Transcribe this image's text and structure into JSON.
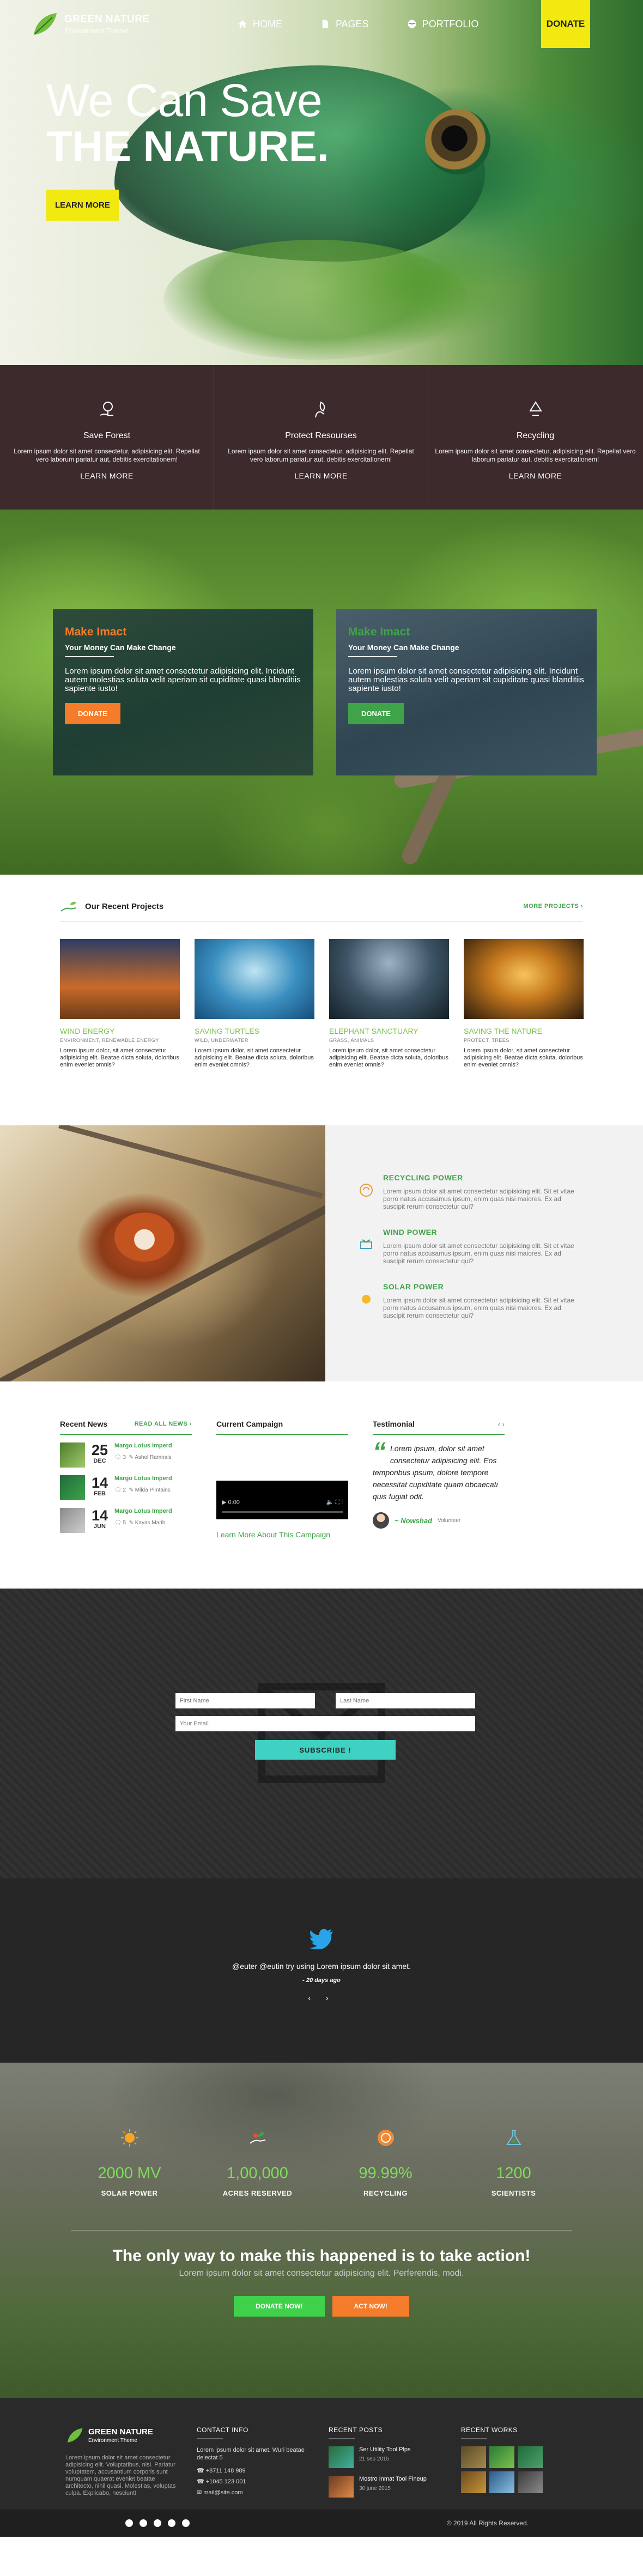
{
  "brand": {
    "title": "GREEN NATURE",
    "subtitle": "Environment Theme"
  },
  "nav": {
    "items": [
      {
        "label": "HOME",
        "icon": "home-icon"
      },
      {
        "label": "PAGES",
        "icon": "page-icon"
      },
      {
        "label": "PORTFOLIO",
        "icon": "globe-icon"
      }
    ],
    "donate": "DONATE"
  },
  "hero": {
    "line1": "We Can Save",
    "line2": "THE NATURE.",
    "button": "LEARN MORE"
  },
  "features": [
    {
      "icon": "tree-hand-icon",
      "title": "Save Forest",
      "text": "Lorem ipsum dolor sit amet consectetur, adipisicing elit. Repellat vero laborum pariatur aut, debitis exercitationem!",
      "button": "LEARN MORE"
    },
    {
      "icon": "hand-leaf-icon",
      "title": "Protect Resourses",
      "text": "Lorem ipsum dolor sit amet consectetur, adipisicing elit. Repellat vero laborum pariatur aut, debitis exercitationem!",
      "button": "LEARN MORE"
    },
    {
      "icon": "recycle-icon",
      "title": "Recycling",
      "text": "Lorem ipsum dolor sit amet consectetur, adipisicing elit. Repellat vero laborum pariatur aut, debitis exercitationem!",
      "button": "LEARN MORE"
    }
  ],
  "cards": [
    {
      "title": "Make Imact",
      "subtitle": "Your Money Can Make Change",
      "text": "Lorem ipsum dolor sit amet consectetur adipisicing elit. Incidunt autem molestias soluta velit aperiam sit cupiditate quasi blanditiis sapiente iusto!",
      "button": "DONATE"
    },
    {
      "title": "Make Imact",
      "subtitle": "Your Money Can Make Change",
      "text": "Lorem ipsum dolor sit amet consectetur adipisicing elit. Incidunt autem molestias soluta velit aperiam sit cupiditate quasi blanditiis sapiente iusto!",
      "button": "DONATE"
    }
  ],
  "projects": {
    "heading": "Our Recent Projects",
    "more": "MORE PROJECTS  ›",
    "items": [
      {
        "title": "WIND ENERGY",
        "tags": "ENVIRONMENT, RENEWABLE ENERGY",
        "text": "Lorem ipsum dolor, sit amet consectetur adipisicing elit. Beatae dicta soluta, doloribus enim eveniet omnis?"
      },
      {
        "title": "SAVING TURTLES",
        "tags": "WILD, UNDERWATER",
        "text": "Lorem ipsum dolor, sit amet consectetur adipisicing elit. Beatae dicta soluta, doloribus enim eveniet omnis?"
      },
      {
        "title": "ELEPHANT SANCTUARY",
        "tags": "GRASS, ANIMALS",
        "text": "Lorem ipsum dolor, sit amet consectetur adipisicing elit. Beatae dicta soluta, doloribus enim eveniet omnis?"
      },
      {
        "title": "SAVING THE NATURE",
        "tags": "PROTECT, TREES",
        "text": "Lorem ipsum dolor, sit amet consectetur adipisicing elit. Beatae dicta soluta, doloribus enim eveniet omnis?"
      }
    ]
  },
  "power": [
    {
      "icon": "recycle-power-icon",
      "title": "RECYCLING POWER",
      "text": "Lorem ipsum dolor sit amet consectetur adipisicing elit. Sit et vitae porro natus accusamus ipsum, enim quas nisi maiores. Ex ad suscipit rerum consectetur qui?"
    },
    {
      "icon": "wind-power-icon",
      "title": "WIND POWER",
      "text": "Lorem ipsum dolor sit amet consectetur adipisicing elit. Sit et vitae porro natus accusamus ipsum, enim quas nisi maiores. Ex ad suscipit rerum consectetur qui?"
    },
    {
      "icon": "solar-power-icon",
      "title": "SOLAR POWER",
      "text": "Lorem ipsum dolor sit amet consectetur adipisicing elit. Sit et vitae porro natus accusamus ipsum, enim quas nisi maiores. Ex ad suscipit rerum consectetur qui?"
    }
  ],
  "news": {
    "heading": "Recent News",
    "readall": "READ ALL NEWS ›",
    "items": [
      {
        "day": "25",
        "month": "DEC",
        "title": "Margo Lotus Imperd",
        "comments": "3",
        "author": "Ashol Ramnais"
      },
      {
        "day": "14",
        "month": "FEB",
        "title": "Margo Lotus Imperd",
        "comments": "2",
        "author": "Milda Pimtains"
      },
      {
        "day": "14",
        "month": "JUN",
        "title": "Margo Lotus Imperd",
        "comments": "5",
        "author": "Kayas Marib"
      }
    ]
  },
  "campaign": {
    "heading": "Current Campaign",
    "time": "0:00",
    "link": "Learn More About This Campaign"
  },
  "testimonial": {
    "heading": "Testimonial",
    "nav": "‹ ›",
    "quote": "Lorem ipsum, dolor sit amet consectetur adipisicing elit. Eos temporibus ipsum, dolore tempore necessitat cupiditate quam obcaecati quis fugiat odit.",
    "author": "~ Nowshad",
    "role": "Volunteer"
  },
  "newsletter": {
    "first": "First Name",
    "last": "Last Name",
    "email": "Your Email",
    "button": "SUBSCRIBE !"
  },
  "tweet": {
    "text": "@euter @eutin try using Lorem ipsum dolor sit amet.",
    "handle": "@euter @eutin",
    "ago": "- 20 days ago",
    "arrows": "‹ ›"
  },
  "stats": {
    "items": [
      {
        "icon": "sun-icon",
        "value": "2000 MV",
        "label": "SOLAR POWER"
      },
      {
        "icon": "hand-plant-icon",
        "value": "1,00,000",
        "label": "ACRES RESERVED"
      },
      {
        "icon": "recycle-badge-icon",
        "value": "99.99%",
        "label": "RECYCLING"
      },
      {
        "icon": "scientist-icon",
        "value": "1200",
        "label": "SCIENTISTS"
      }
    ],
    "headline": "The only way to make this happened is to take action!",
    "sub": "Lorem ipsum dolor sit amet consectetur adipisicing elit. Perferendis, modi.",
    "btn1": "DONATE NOW!",
    "btn2": "ACT NOW!"
  },
  "footer": {
    "about_text": "Lorem ipsum dolor sit amet consectetur adipisicing elit. Voluptatibus, nisi. Pariatur voluptatem, accusantium corporis sunt numquam quaerat eveniet beatae architecto, nihil quasi. Molestias, voluptas culpa. Explicabo, nesciunt!",
    "contact_heading": "CONTACT INFO",
    "contact_address": "Lorem ipsum dolor sit amet. Wuri beatae delectat 5",
    "contact_phone1": "☎ +8711 148 989",
    "contact_phone2": "☎ +1045 123 001",
    "contact_email": "✉ mail@site.com",
    "posts_heading": "RECENT POSTS",
    "posts": [
      {
        "title": "Ser Utility Tool Plps",
        "date": "21 sep 2015"
      },
      {
        "title": "Mostro Inmat Tool Fineup",
        "date": "30 june 2015"
      }
    ],
    "works_heading": "RECENT WORKS",
    "copyright": "© 2019 All Rights Reserved."
  },
  "colors": {
    "accent": "#3fa34a",
    "yellow": "#f1e90f",
    "orange": "#f57c2a",
    "teal": "#3fd1c1"
  }
}
